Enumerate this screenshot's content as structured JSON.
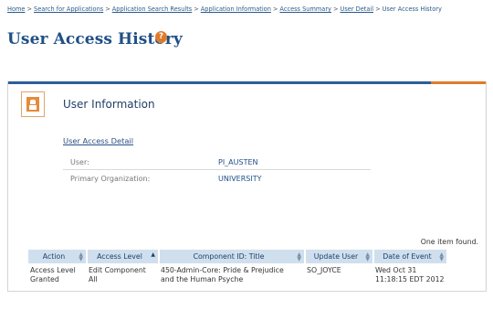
{
  "breadcrumb": {
    "items": [
      "Home",
      "Search for Applications",
      "Application Search Results",
      "Application Information",
      "Access Summary",
      "User Detail"
    ],
    "current": "User Access History",
    "separator": ">"
  },
  "page": {
    "title": "User Access History",
    "help_glyph": "?"
  },
  "panel": {
    "heading": "User Information",
    "icon": "user-info-icon",
    "detail_link": "User Access Detail",
    "fields": {
      "user_label": "User:",
      "user_value": "PI_AUSTEN",
      "org_label": "Primary Organization:",
      "org_value": "UNIVERSITY"
    }
  },
  "results": {
    "count_text": "One item found.",
    "columns": [
      "Action",
      "Access Level",
      "Component ID: Title",
      "Update User",
      "Date of Event"
    ],
    "rows": [
      {
        "action_line1": "Access Level",
        "action_line2": "Granted",
        "access_line1": "Edit Component",
        "access_line2": "All",
        "component_line1": "450-Admin-Core: Pride & Prejudice",
        "component_line2": "and the Human Psyche",
        "update_user": "SO_JOYCE",
        "date_line1": "Wed Oct 31",
        "date_line2": "11:18:15 EDT 2012"
      }
    ]
  },
  "colors": {
    "title_blue": "#1f4f86",
    "header_bg": "#cfdfee",
    "accent_orange": "#e07b2a",
    "topbar_blue": "#2b5f99"
  }
}
